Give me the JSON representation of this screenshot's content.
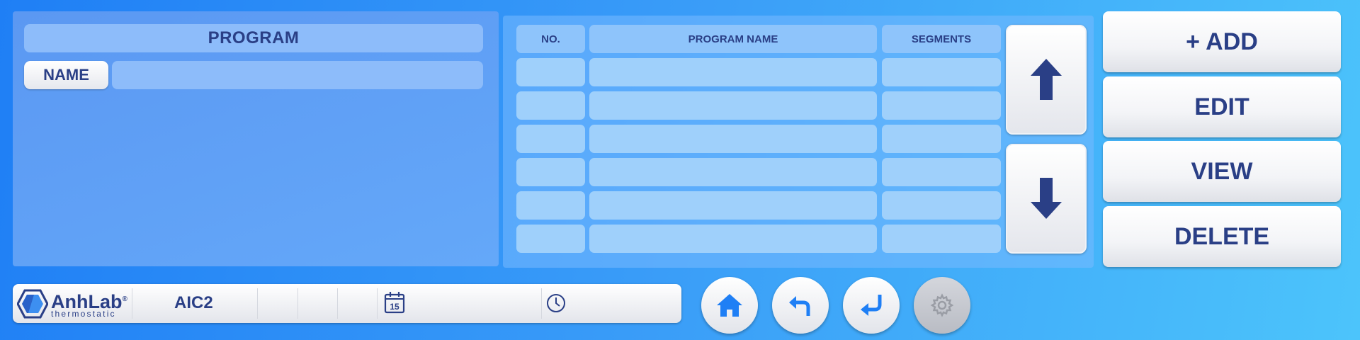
{
  "program_panel": {
    "title": "PROGRAM",
    "name_label": "NAME",
    "name_value": ""
  },
  "program_table": {
    "columns": [
      "NO.",
      "PROGRAM NAME",
      "SEGMENTS"
    ],
    "rows": [
      [
        "",
        "",
        ""
      ],
      [
        "",
        "",
        ""
      ],
      [
        "",
        "",
        ""
      ],
      [
        "",
        "",
        ""
      ],
      [
        "",
        "",
        ""
      ],
      [
        "",
        "",
        ""
      ]
    ]
  },
  "scroll": {
    "up_icon": "arrow-up-icon",
    "down_icon": "arrow-down-icon"
  },
  "actions": {
    "add_label": "+ ADD",
    "edit_label": "EDIT",
    "view_label": "VIEW",
    "delete_label": "DELETE"
  },
  "status_bar": {
    "logo_name": "AnhLab",
    "logo_registered": "®",
    "logo_tagline": "thermostatic",
    "device_name": "AIC2",
    "date_icon": "calendar-icon",
    "calendar_day": "15",
    "date_value": "",
    "time_icon": "clock-icon",
    "time_value": ""
  },
  "nav": {
    "home_icon": "home-icon",
    "back_icon": "back-arrow-icon",
    "enter_icon": "enter-arrow-icon",
    "settings_icon": "gear-icon",
    "settings_enabled": false
  },
  "colors": {
    "text_primary": "#2a3f86",
    "icon_blue": "#1f7ff5",
    "arrow_dark": "#2a3f86"
  }
}
